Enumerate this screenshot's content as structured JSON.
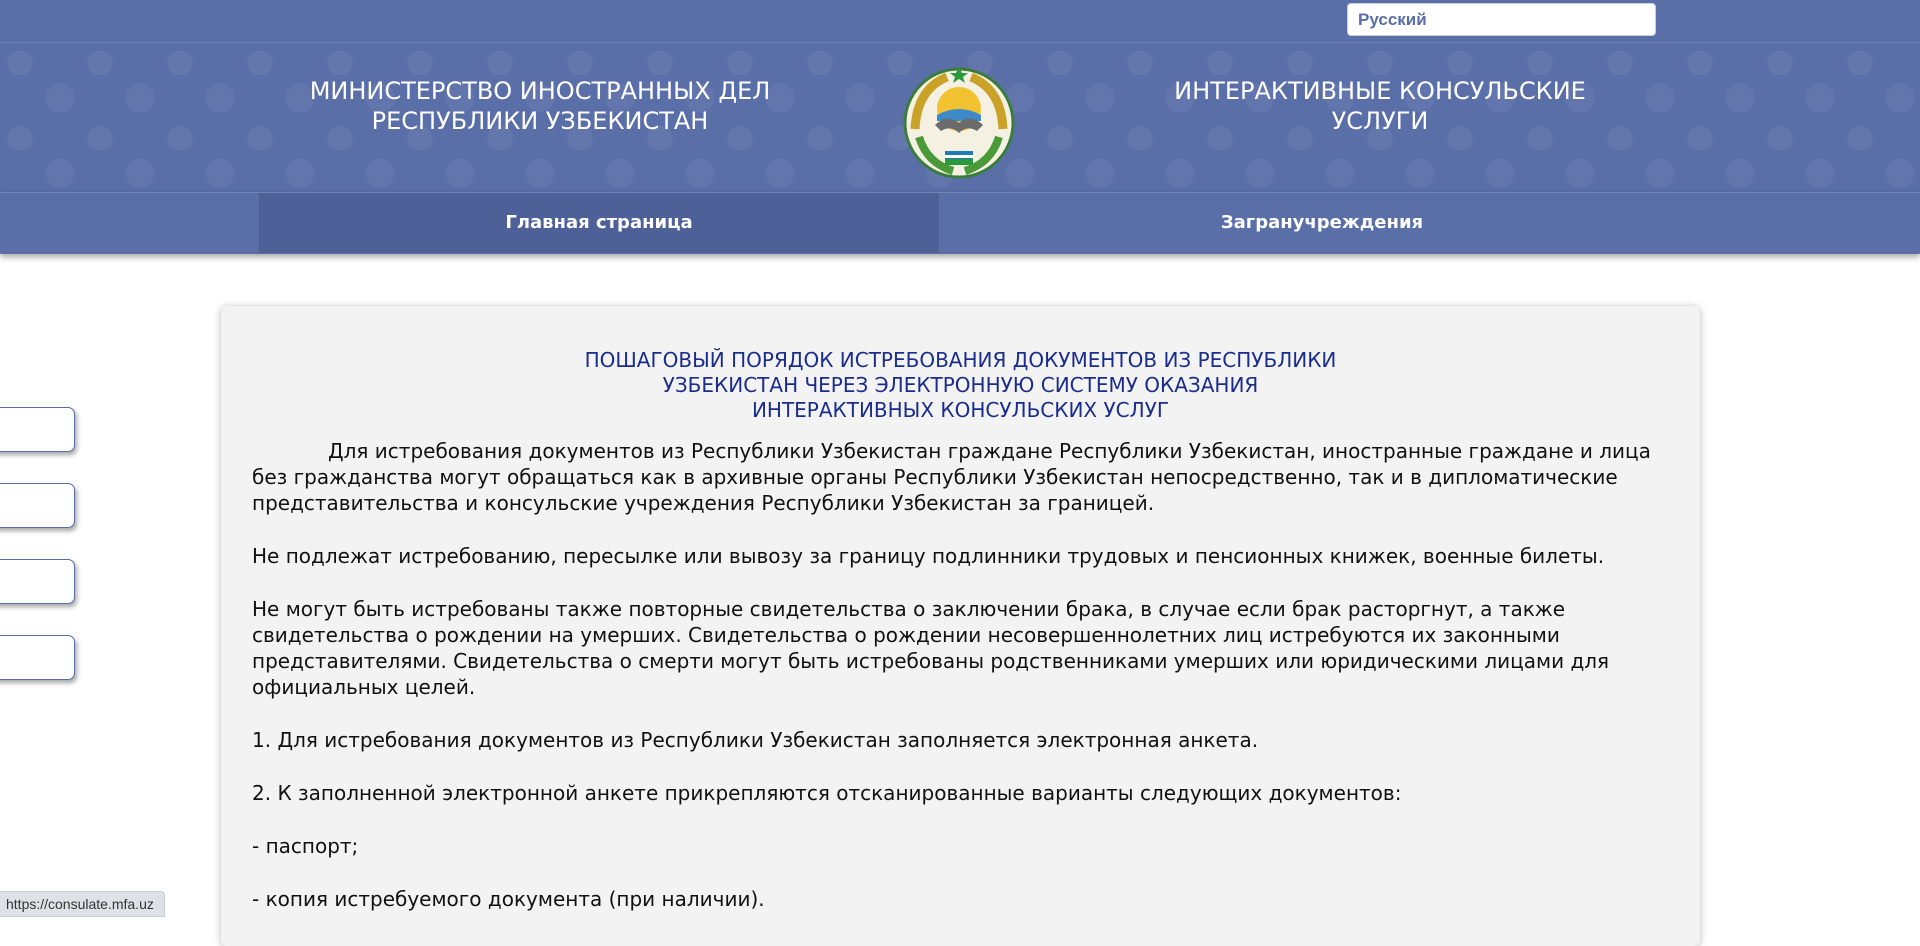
{
  "language": {
    "selected": "Русский"
  },
  "header": {
    "left_title_line1": "МИНИСТЕРСТВО ИНОСТРАННЫХ ДЕЛ",
    "left_title_line2": "РЕСПУБЛИКИ УЗБЕКИСТАН",
    "right_title_line1": "ИНТЕРАКТИВНЫЕ КОНСУЛЬСКИЕ",
    "right_title_line2": "УСЛУГИ",
    "emblem_icon": "uzbekistan-emblem-icon"
  },
  "nav": {
    "items": [
      {
        "label": "Главная страница",
        "active": true
      },
      {
        "label": "Загранучреждения",
        "active": false
      }
    ]
  },
  "sidebar": {
    "buttons": [
      {
        "label": ""
      },
      {
        "label": ""
      },
      {
        "label": ""
      },
      {
        "label": ""
      }
    ]
  },
  "content": {
    "title_line1": "ПОШАГОВЫЙ ПОРЯДОК ИСТРЕБОВАНИЯ ДОКУМЕНТОВ ИЗ РЕСПУБЛИКИ",
    "title_line2": "УЗБЕКИСТАН ЧЕРЕЗ ЭЛЕКТРОННУЮ СИСТЕМУ ОКАЗАНИЯ",
    "title_line3": "ИНТЕРАКТИВНЫХ КОНСУЛЬСКИХ УСЛУГ",
    "paragraphs": [
      "Для истребования документов из Республики Узбекистан граждане Республики Узбекистан, иностранные граждане и лица без гражданства могут обращаться как в архивные органы Республики Узбекистан непосредственно, так и в дипломатические представительства и консульские учреждения Республики Узбекистан за границей.",
      "Не подлежат истребованию, пересылке или вывозу за границу подлинники трудовых и пенсионных книжек, военные билеты.",
      "Не могут быть истребованы также повторные свидетельства о заключении брака, в случае если брак расторгнут, а также свидетельства о рождении на умерших. Свидетельства о рождении несовершеннолетних лиц истребуются их законными представителями. Свидетельства о смерти могут быть истребованы родственниками умерших или юридическими лицами для официальных целей.",
      "1. Для истребования документов из Республики Узбекистан заполняется электронная анкета.",
      "2. К заполненной электронной анкете прикрепляются отсканированные варианты следующих документов:",
      "- паспорт;",
      "- копия истребуемого документа (при наличии)."
    ]
  },
  "status_bar": {
    "url": "https://consulate.mfa.uz"
  },
  "colors": {
    "header_bg": "#5a6ea8",
    "nav_active_bg": "#4e6098",
    "title_color": "#1b2d8c",
    "card_bg": "#f3f3f3"
  }
}
